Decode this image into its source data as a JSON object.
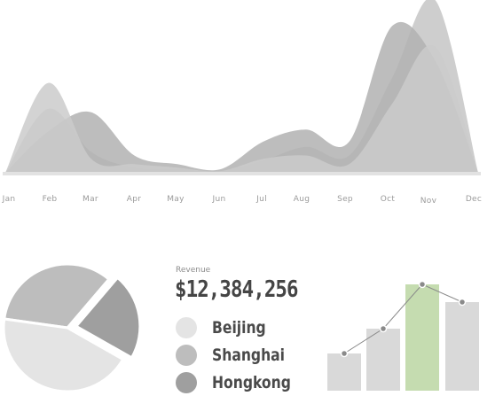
{
  "revenue": {
    "label": "Revenue",
    "value": "$12,384,256"
  },
  "legend": [
    {
      "name": "Beijing",
      "color": "#e4e4e4"
    },
    {
      "name": "Shanghai",
      "color": "#bdbdbd"
    },
    {
      "name": "Hongkong",
      "color": "#9f9f9f"
    }
  ],
  "chart_data": [
    {
      "type": "area",
      "categories": [
        "Jan",
        "Feb",
        "Mar",
        "Apr",
        "May",
        "Jun",
        "Jul",
        "Aug",
        "Sep",
        "Oct",
        "Nov",
        "Dec"
      ],
      "series": [
        {
          "values": [
            0,
            37,
            12,
            3,
            2,
            1,
            7,
            15,
            10,
            55,
            100,
            0
          ],
          "color": "#c6c6c6"
        },
        {
          "values": [
            0,
            24,
            35,
            10,
            5,
            2,
            18,
            25,
            18,
            85,
            65,
            0
          ],
          "color": "#b1b1b1"
        },
        {
          "values": [
            0,
            52,
            8,
            5,
            3,
            1,
            8,
            10,
            5,
            40,
            73,
            0
          ],
          "color": "#cbcbcb"
        }
      ],
      "grid": false
    },
    {
      "type": "pie",
      "values": [
        34,
        22,
        44
      ],
      "colors": [
        "#bdbdbd",
        "#9f9f9f",
        "#e4e4e4"
      ]
    },
    {
      "type": "bar",
      "values": [
        42,
        70,
        120,
        100
      ],
      "colors": [
        "#d9d9d9",
        "#d9d9d9",
        "#c5dcb0",
        "#d9d9d9"
      ],
      "line_values": [
        42,
        70,
        120,
        100
      ],
      "ylim": [
        0,
        125
      ]
    }
  ]
}
